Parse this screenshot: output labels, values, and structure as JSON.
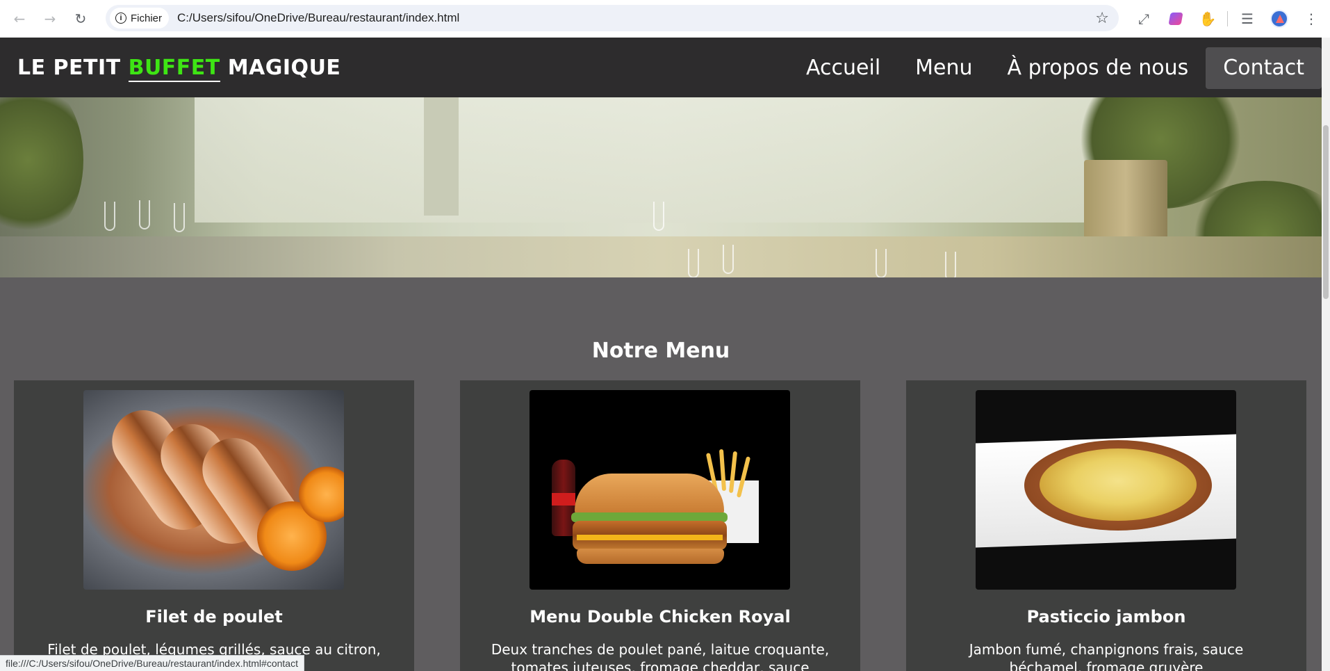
{
  "browser": {
    "site_chip": "Fichier",
    "url": "C:/Users/sifou/OneDrive/Bureau/restaurant/index.html",
    "status_url": "file:///C:/Users/sifou/OneDrive/Bureau/restaurant/index.html#contact",
    "icons": [
      "back-icon",
      "forward-icon",
      "reload-icon",
      "info-icon",
      "bookmark-star-icon",
      "fullscreen-icon",
      "gemini-icon",
      "extensions-icon",
      "media-queue-icon",
      "profile-avatar",
      "more-menu-icon"
    ]
  },
  "header": {
    "logo_part1": "LE PETIT",
    "logo_accent": "BUFFET",
    "logo_part2": "MAGIQUE",
    "nav": [
      {
        "label": "Accueil"
      },
      {
        "label": "Menu"
      },
      {
        "label": "À propos de nous"
      },
      {
        "label": "Contact"
      }
    ],
    "active_nav": "Contact"
  },
  "colors": {
    "header_bg": "#2d2c2d",
    "logo_accent": "#3ee514",
    "section_bg": "#5f5d5f",
    "card_bg": "#3f403f"
  },
  "menu_section": {
    "title": "Notre Menu",
    "items": [
      {
        "name": "Filet de poulet",
        "description": "Filet de poulet, légumes grillés, sauce au citron, herbes"
      },
      {
        "name": "Menu Double Chicken Royal",
        "description": "Deux tranches de poulet pané, laitue croquante, tomates juteuses, fromage cheddar, sauce spéciale, le tout servi dans"
      },
      {
        "name": "Pasticcio jambon",
        "description": "Jambon fumé, chanpignons frais, sauce béchamel, fromage gruyère"
      }
    ]
  }
}
